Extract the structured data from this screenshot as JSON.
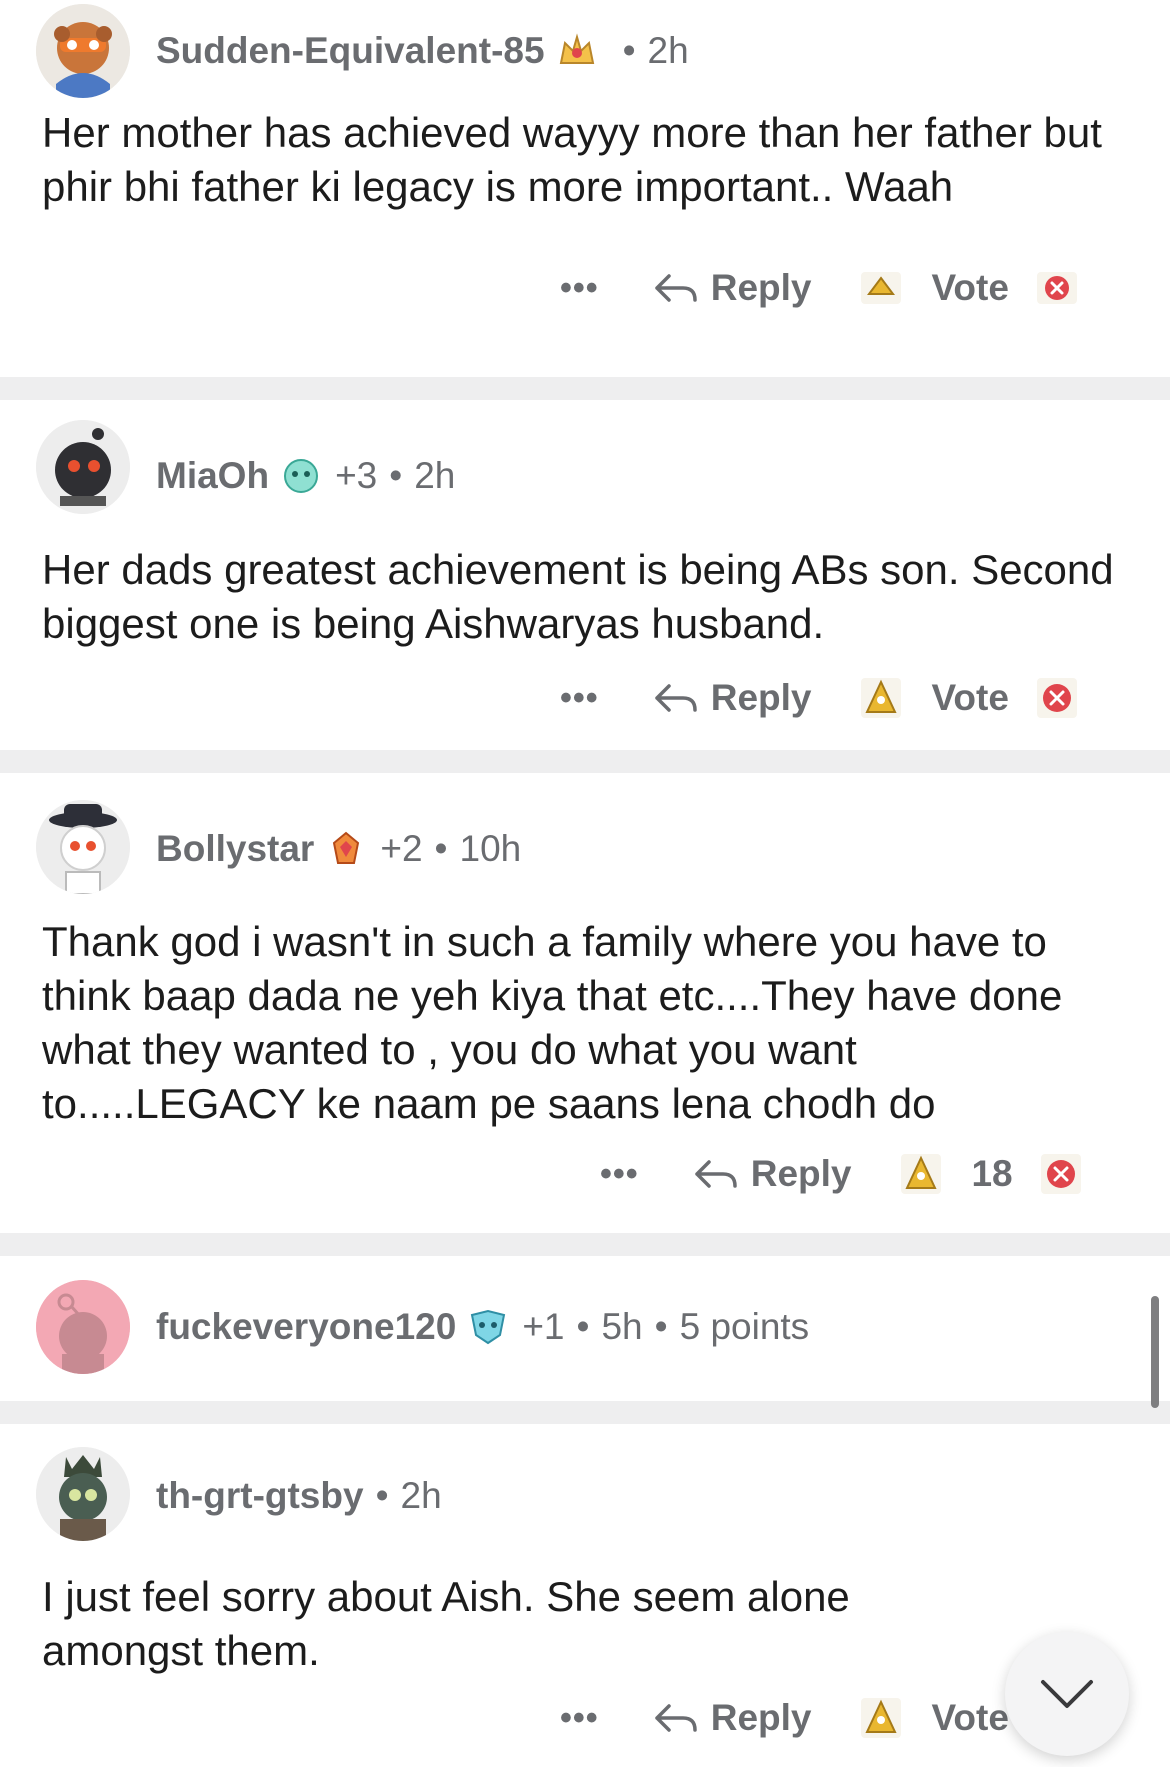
{
  "comments": [
    {
      "username": "Sudden-Equivalent-85",
      "karma": "",
      "age": "2h",
      "body": "Her mother has achieved wayyy more than her father but phir bhi father ki legacy is more important.. Waah",
      "actions": {
        "more": "•••",
        "reply": "Reply",
        "vote": "Vote"
      }
    },
    {
      "username": "MiaOh",
      "karma": "+3",
      "age": "2h",
      "body": "Her dads greatest achievement is being ABs son. Second biggest one is being Aishwaryas husband.",
      "actions": {
        "more": "•••",
        "reply": "Reply",
        "vote": "Vote"
      }
    },
    {
      "username": "Bollystar",
      "karma": "+2",
      "age": "10h",
      "body": "Thank god i wasn't in such a family where you have to think baap dada ne yeh kiya that etc....They have done what they wanted to , you do what you want to.....LEGACY ke naam pe saans lena chodh do",
      "actions": {
        "more": "•••",
        "reply": "Reply",
        "vote": "18"
      }
    },
    {
      "username": "fuckeveryone120",
      "karma": "+1",
      "age": "5h",
      "points": "5 points",
      "collapsed": true
    },
    {
      "username": "th-grt-gtsby",
      "karma": "",
      "age": "2h",
      "body": "I just feel sorry about Aish. She seem alone amongst them.",
      "actions": {
        "more": "•••",
        "reply": "Reply",
        "vote": "Vote"
      }
    }
  ],
  "icons": {
    "reply": "reply-arrow-icon",
    "upvote": "upvote-award-icon",
    "downvote": "downvote-x-icon",
    "collapse": "chevron-down-icon"
  },
  "colors": {
    "text": "#1c1c1c",
    "meta": "#6a6c70",
    "separator": "#eeeeef",
    "downvote": "#e0454c",
    "upvote_gold": "#e9b730",
    "avatar_pink": "#f3a8b4"
  }
}
